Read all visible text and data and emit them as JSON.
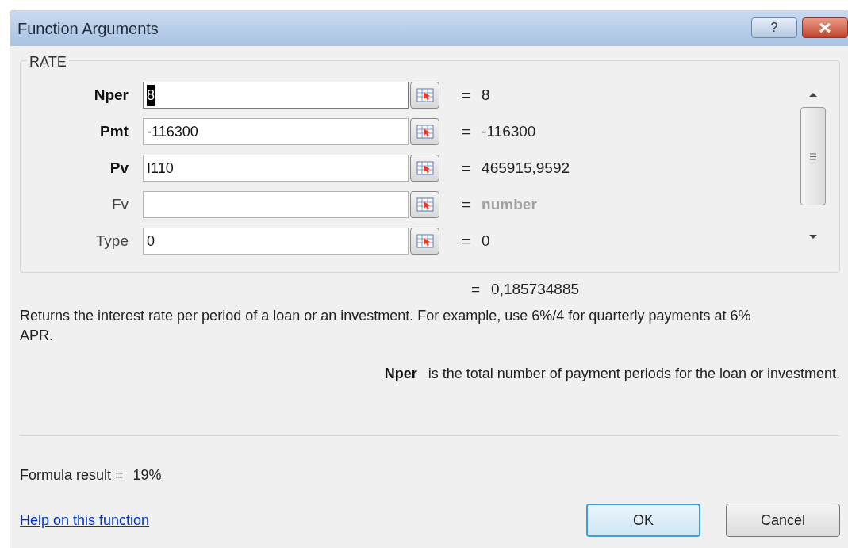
{
  "window": {
    "title": "Function Arguments",
    "help_button": "?"
  },
  "function": {
    "name": "RATE"
  },
  "arguments": [
    {
      "name": "Nper",
      "required": true,
      "value": "8",
      "selected": true,
      "sign": "=",
      "result": "8",
      "kind": "value"
    },
    {
      "name": "Pmt",
      "required": true,
      "value": "-116300",
      "selected": false,
      "sign": "=",
      "result": "-116300",
      "kind": "value"
    },
    {
      "name": "Pv",
      "required": true,
      "value": "I110",
      "selected": false,
      "sign": "=",
      "result": "465915,9592",
      "kind": "value"
    },
    {
      "name": "Fv",
      "required": false,
      "selected": false,
      "sign": "=",
      "result": "number",
      "kind": "hint"
    },
    {
      "name": "Type",
      "required": false,
      "value": "0",
      "selected": false,
      "sign": "=",
      "result": "0",
      "kind": "value"
    }
  ],
  "result_line": {
    "sign": "=",
    "value": "0,185734885"
  },
  "description": "Returns the interest rate per period of a loan or an investment. For example, use 6%/4 for quarterly payments at 6% APR.",
  "argument_help": {
    "name": "Nper",
    "text": "is the total number of payment periods for the loan or investment."
  },
  "formula_result": {
    "label": "Formula result =",
    "value": "19%"
  },
  "help_link": "Help on this function",
  "buttons": [
    {
      "label": "OK",
      "default": true
    },
    {
      "label": "Cancel",
      "default": false
    }
  ]
}
